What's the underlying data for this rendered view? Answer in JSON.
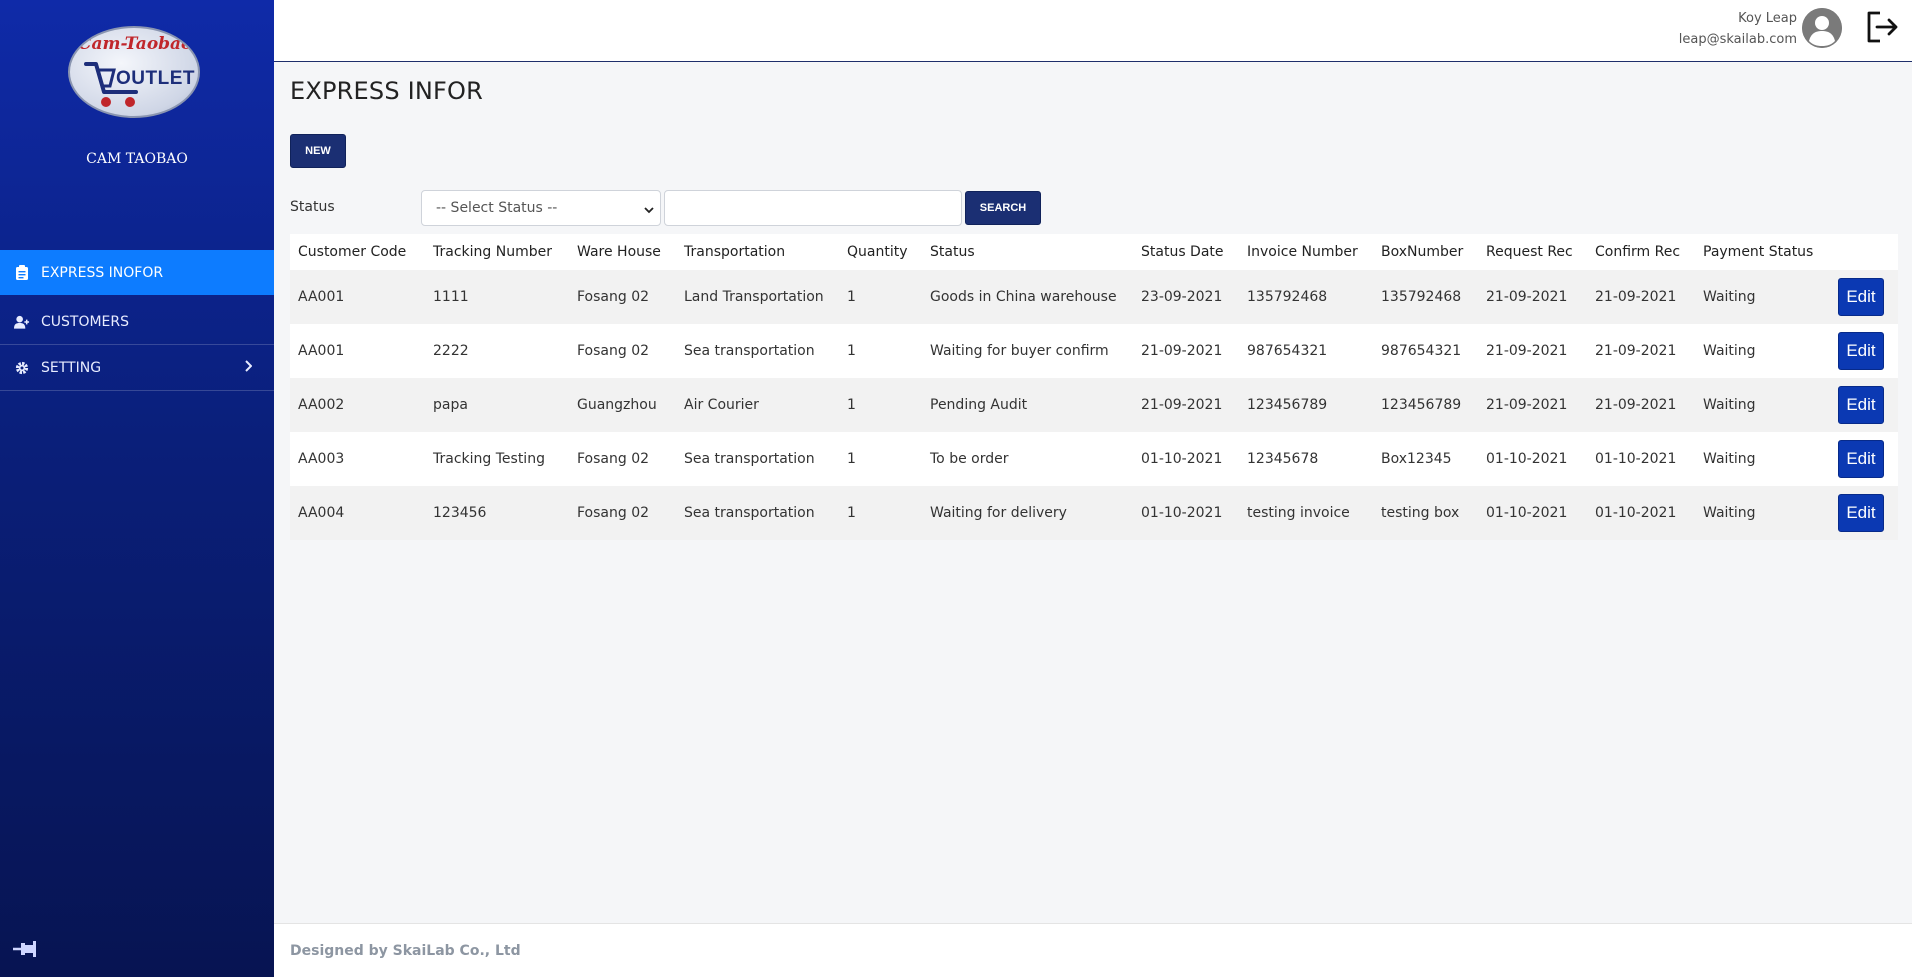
{
  "sidebar": {
    "logo_top_text": "Cam-Taobao",
    "logo_main_text": "OUTLET",
    "brand_name": "CAM TAOBAO",
    "items": [
      {
        "label": "EXPRESS INOFOR",
        "icon": "clipboard-icon",
        "active": true
      },
      {
        "label": "CUSTOMERS",
        "icon": "users-icon",
        "active": false
      },
      {
        "label": "SETTING",
        "icon": "gear-icon",
        "active": false
      }
    ],
    "accent_color": "#0d7cff"
  },
  "header": {
    "user_name": "Koy Leap",
    "user_email": "leap@skailab.com"
  },
  "main": {
    "title": "EXPRESS INFOR",
    "new_label": "NEW",
    "filter_label": "Status",
    "status_select": "-- Select Status --",
    "search_value": "",
    "search_label": "SEARCH",
    "columns": [
      "Customer Code",
      "Tracking Number",
      "Ware House",
      "Transportation",
      "Quantity",
      "Status",
      "Status Date",
      "Invoice Number",
      "BoxNumber",
      "Request Rec",
      "Confirm Rec",
      "Payment Status"
    ],
    "edit_label": "Edit",
    "rows": [
      [
        "AA001",
        "1111",
        "Fosang 02",
        "Land Transportation",
        "1",
        "Goods in China warehouse",
        "23-09-2021",
        "135792468",
        "135792468",
        "21-09-2021",
        "21-09-2021",
        "Waiting"
      ],
      [
        "AA001",
        "2222",
        "Fosang 02",
        "Sea transportation",
        "1",
        "Waiting for buyer confirm",
        "21-09-2021",
        "987654321",
        "987654321",
        "21-09-2021",
        "21-09-2021",
        "Waiting"
      ],
      [
        "AA002",
        "papa",
        "Guangzhou",
        "Air Courier",
        "1",
        "Pending Audit",
        "21-09-2021",
        "123456789",
        "123456789",
        "21-09-2021",
        "21-09-2021",
        "Waiting"
      ],
      [
        "AA003",
        "Tracking Testing",
        "Fosang 02",
        "Sea transportation",
        "1",
        "To be order",
        "01-10-2021",
        "12345678",
        "Box12345",
        "01-10-2021",
        "01-10-2021",
        "Waiting"
      ],
      [
        "AA004",
        "123456",
        "Fosang 02",
        "Sea transportation",
        "1",
        "Waiting for delivery",
        "01-10-2021",
        "testing invoice",
        "testing box",
        "01-10-2021",
        "01-10-2021",
        "Waiting"
      ]
    ]
  },
  "footer": {
    "text": "Designed by SkaiLab Co., Ltd"
  }
}
